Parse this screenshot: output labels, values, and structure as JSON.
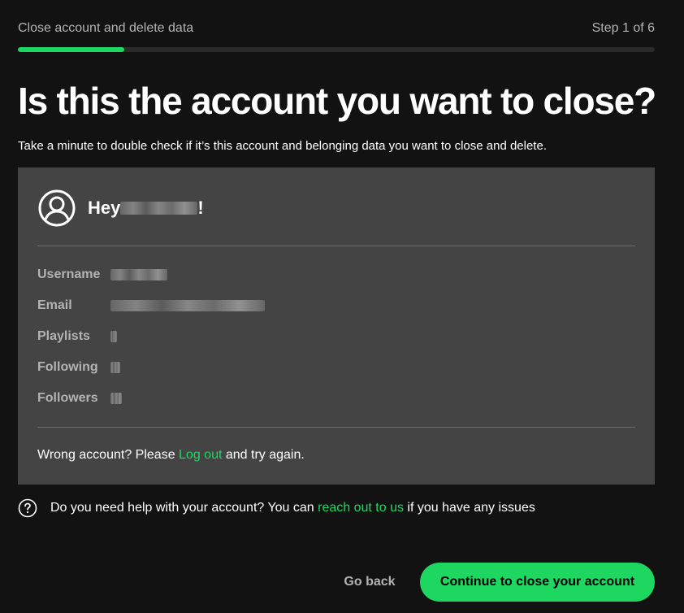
{
  "header": {
    "flow_title": "Close account and delete data",
    "step_text": "Step 1 of 6",
    "progress_fraction": 0.1667
  },
  "main": {
    "title": "Is this the account you want to close?",
    "subtitle": "Take a minute to double check if it’s this account and belonging data you want to close and delete."
  },
  "card": {
    "greeting_prefix": "Hey",
    "greeting_suffix": "!",
    "fields": [
      {
        "label": "Username"
      },
      {
        "label": "Email"
      },
      {
        "label": "Playlists"
      },
      {
        "label": "Following"
      },
      {
        "label": "Followers"
      }
    ],
    "wrong_account_prefix": "Wrong account? Please ",
    "logout_link": "Log out",
    "wrong_account_suffix": " and try again."
  },
  "help": {
    "prefix": "Do you need help with your account? You can ",
    "link": "reach out to us",
    "suffix": " if you have any issues"
  },
  "actions": {
    "back_label": "Go back",
    "continue_label": "Continue to close your account"
  },
  "colors": {
    "accent": "#1ed760",
    "background": "#121212",
    "card": "#444444"
  }
}
